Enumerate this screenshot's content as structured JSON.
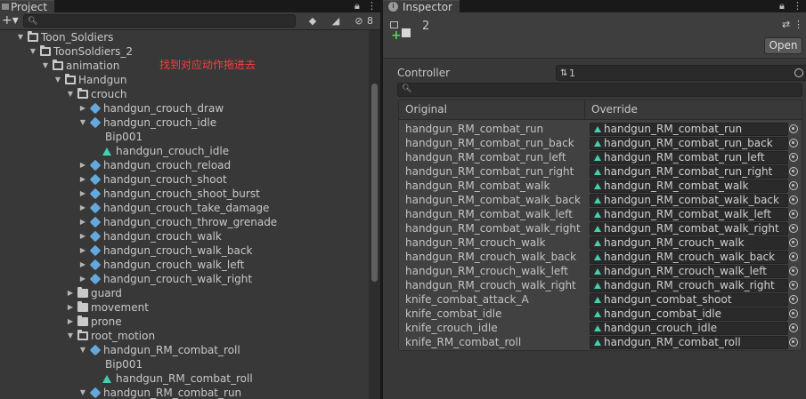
{
  "project": {
    "tab_label": "Project",
    "filter_count": "8",
    "hint_text": "找到对应动作拖进去",
    "tree": [
      {
        "label": "Toon_Soldiers",
        "icon": "folder-open",
        "depth": 0,
        "arrow": "down"
      },
      {
        "label": "ToonSoldiers_2",
        "icon": "folder-open",
        "depth": 1,
        "arrow": "down"
      },
      {
        "label": "animation",
        "icon": "folder-open",
        "depth": 2,
        "arrow": "down"
      },
      {
        "label": "Handgun",
        "icon": "folder-open",
        "depth": 3,
        "arrow": "down"
      },
      {
        "label": "crouch",
        "icon": "folder-open",
        "depth": 4,
        "arrow": "down"
      },
      {
        "label": "handgun_crouch_draw",
        "icon": "model",
        "depth": 5,
        "arrow": "right"
      },
      {
        "label": "handgun_crouch_idle",
        "icon": "model",
        "depth": 5,
        "arrow": "down"
      },
      {
        "label": "Bip001",
        "icon": "bone",
        "depth": 6,
        "arrow": ""
      },
      {
        "label": "handgun_crouch_idle",
        "icon": "clip",
        "depth": 6,
        "arrow": ""
      },
      {
        "label": "handgun_crouch_reload",
        "icon": "model",
        "depth": 5,
        "arrow": "right"
      },
      {
        "label": "handgun_crouch_shoot",
        "icon": "model",
        "depth": 5,
        "arrow": "right"
      },
      {
        "label": "handgun_crouch_shoot_burst",
        "icon": "model",
        "depth": 5,
        "arrow": "right"
      },
      {
        "label": "handgun_crouch_take_damage",
        "icon": "model",
        "depth": 5,
        "arrow": "right"
      },
      {
        "label": "handgun_crouch_throw_grenade",
        "icon": "model",
        "depth": 5,
        "arrow": "right"
      },
      {
        "label": "handgun_crouch_walk",
        "icon": "model",
        "depth": 5,
        "arrow": "right"
      },
      {
        "label": "handgun_crouch_walk_back",
        "icon": "model",
        "depth": 5,
        "arrow": "right"
      },
      {
        "label": "handgun_crouch_walk_left",
        "icon": "model",
        "depth": 5,
        "arrow": "right"
      },
      {
        "label": "handgun_crouch_walk_right",
        "icon": "model",
        "depth": 5,
        "arrow": "right"
      },
      {
        "label": "guard",
        "icon": "folder",
        "depth": 4,
        "arrow": "right"
      },
      {
        "label": "movement",
        "icon": "folder",
        "depth": 4,
        "arrow": "right"
      },
      {
        "label": "prone",
        "icon": "folder",
        "depth": 4,
        "arrow": "right"
      },
      {
        "label": "root_motion",
        "icon": "folder-open",
        "depth": 4,
        "arrow": "down"
      },
      {
        "label": "handgun_RM_combat_roll",
        "icon": "model",
        "depth": 5,
        "arrow": "down"
      },
      {
        "label": "Bip001",
        "icon": "bone",
        "depth": 6,
        "arrow": ""
      },
      {
        "label": "handgun_RM_combat_roll",
        "icon": "clip",
        "depth": 6,
        "arrow": ""
      },
      {
        "label": "handgun_RM_combat_run",
        "icon": "model",
        "depth": 5,
        "arrow": "down"
      }
    ]
  },
  "inspector": {
    "tab_label": "Inspector",
    "object_name": "2",
    "open_button": "Open",
    "controller_label": "Controller",
    "controller_value": "1",
    "col_original": "Original",
    "col_override": "Override",
    "overrides": [
      {
        "original": "handgun_RM_combat_run",
        "override": "handgun_RM_combat_run"
      },
      {
        "original": "handgun_RM_combat_run_back",
        "override": "handgun_RM_combat_run_back"
      },
      {
        "original": "handgun_RM_combat_run_left",
        "override": "handgun_RM_combat_run_left"
      },
      {
        "original": "handgun_RM_combat_run_right",
        "override": "handgun_RM_combat_run_right"
      },
      {
        "original": "handgun_RM_combat_walk",
        "override": "handgun_RM_combat_walk"
      },
      {
        "original": "handgun_RM_combat_walk_back",
        "override": "handgun_RM_combat_walk_back"
      },
      {
        "original": "handgun_RM_combat_walk_left",
        "override": "handgun_RM_combat_walk_left"
      },
      {
        "original": "handgun_RM_combat_walk_right",
        "override": "handgun_RM_combat_walk_right"
      },
      {
        "original": "handgun_RM_crouch_walk",
        "override": "handgun_RM_crouch_walk"
      },
      {
        "original": "handgun_RM_crouch_walk_back",
        "override": "handgun_RM_crouch_walk_back"
      },
      {
        "original": "handgun_RM_crouch_walk_left",
        "override": "handgun_RM_crouch_walk_left"
      },
      {
        "original": "handgun_RM_crouch_walk_right",
        "override": "handgun_RM_crouch_walk_right"
      },
      {
        "original": "knife_combat_attack_A",
        "override": "handgun_combat_shoot"
      },
      {
        "original": "knife_combat_idle",
        "override": "handgun_combat_idle"
      },
      {
        "original": "knife_crouch_idle",
        "override": "handgun_crouch_idle"
      },
      {
        "original": "knife_RM_combat_roll",
        "override": "handgun_RM_combat_roll"
      }
    ]
  }
}
